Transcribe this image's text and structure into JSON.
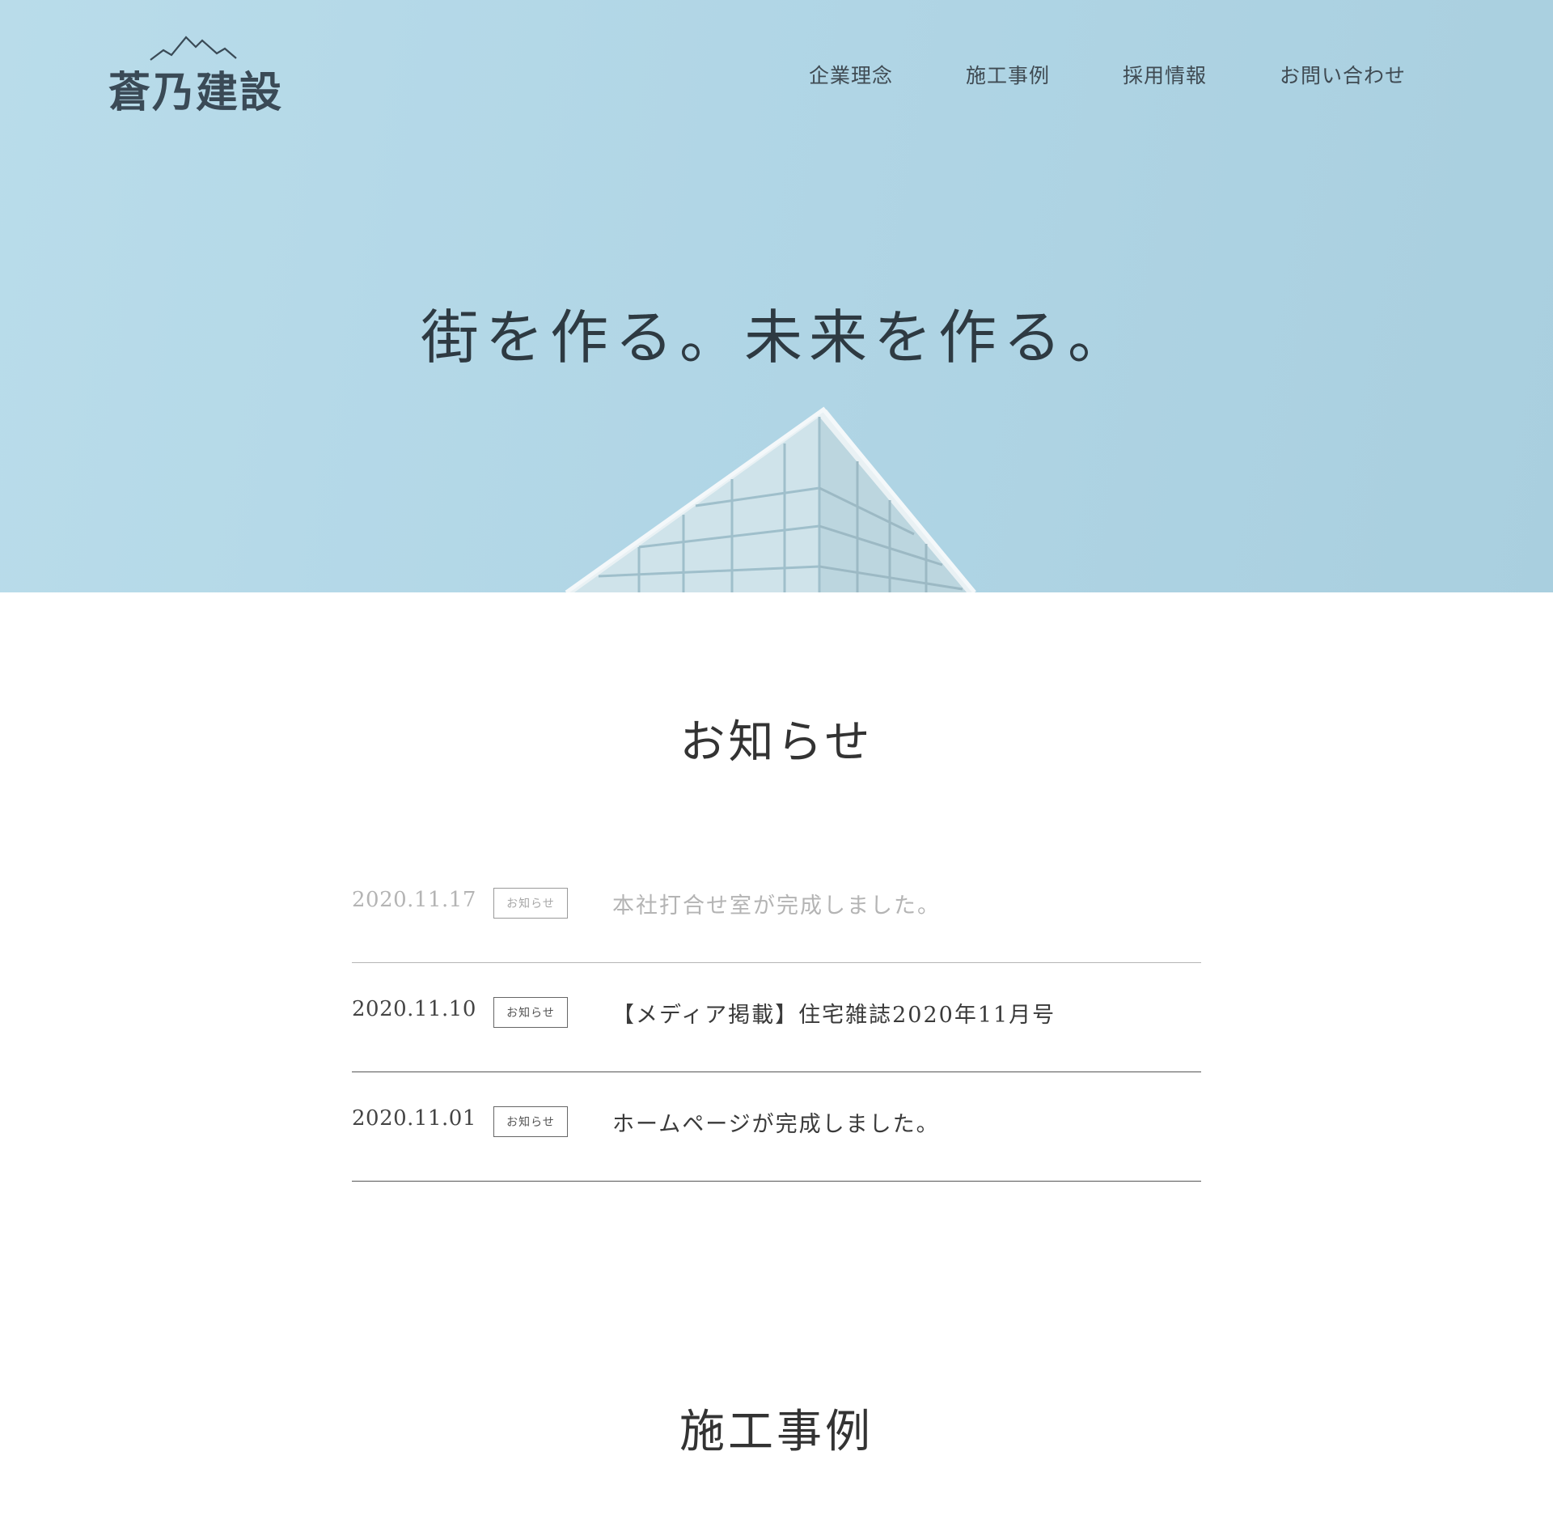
{
  "header": {
    "logo_text": "蒼乃建設",
    "nav": [
      {
        "label": "企業理念"
      },
      {
        "label": "施工事例"
      },
      {
        "label": "採用情報"
      },
      {
        "label": "お問い合わせ"
      }
    ]
  },
  "hero": {
    "title": "街を作る。未来を作る。",
    "background_color": "#b3d7e7"
  },
  "news": {
    "heading": "お知らせ",
    "items": [
      {
        "date": "2020.11.17",
        "tag": "お知らせ",
        "title": "本社打合せ室が完成しました。"
      },
      {
        "date": "2020.11.10",
        "tag": "お知らせ",
        "title": "【メディア掲載】住宅雑誌2020年11月号"
      },
      {
        "date": "2020.11.01",
        "tag": "お知らせ",
        "title": "ホームページが完成しました。"
      }
    ]
  },
  "works": {
    "heading": "施工事例"
  }
}
